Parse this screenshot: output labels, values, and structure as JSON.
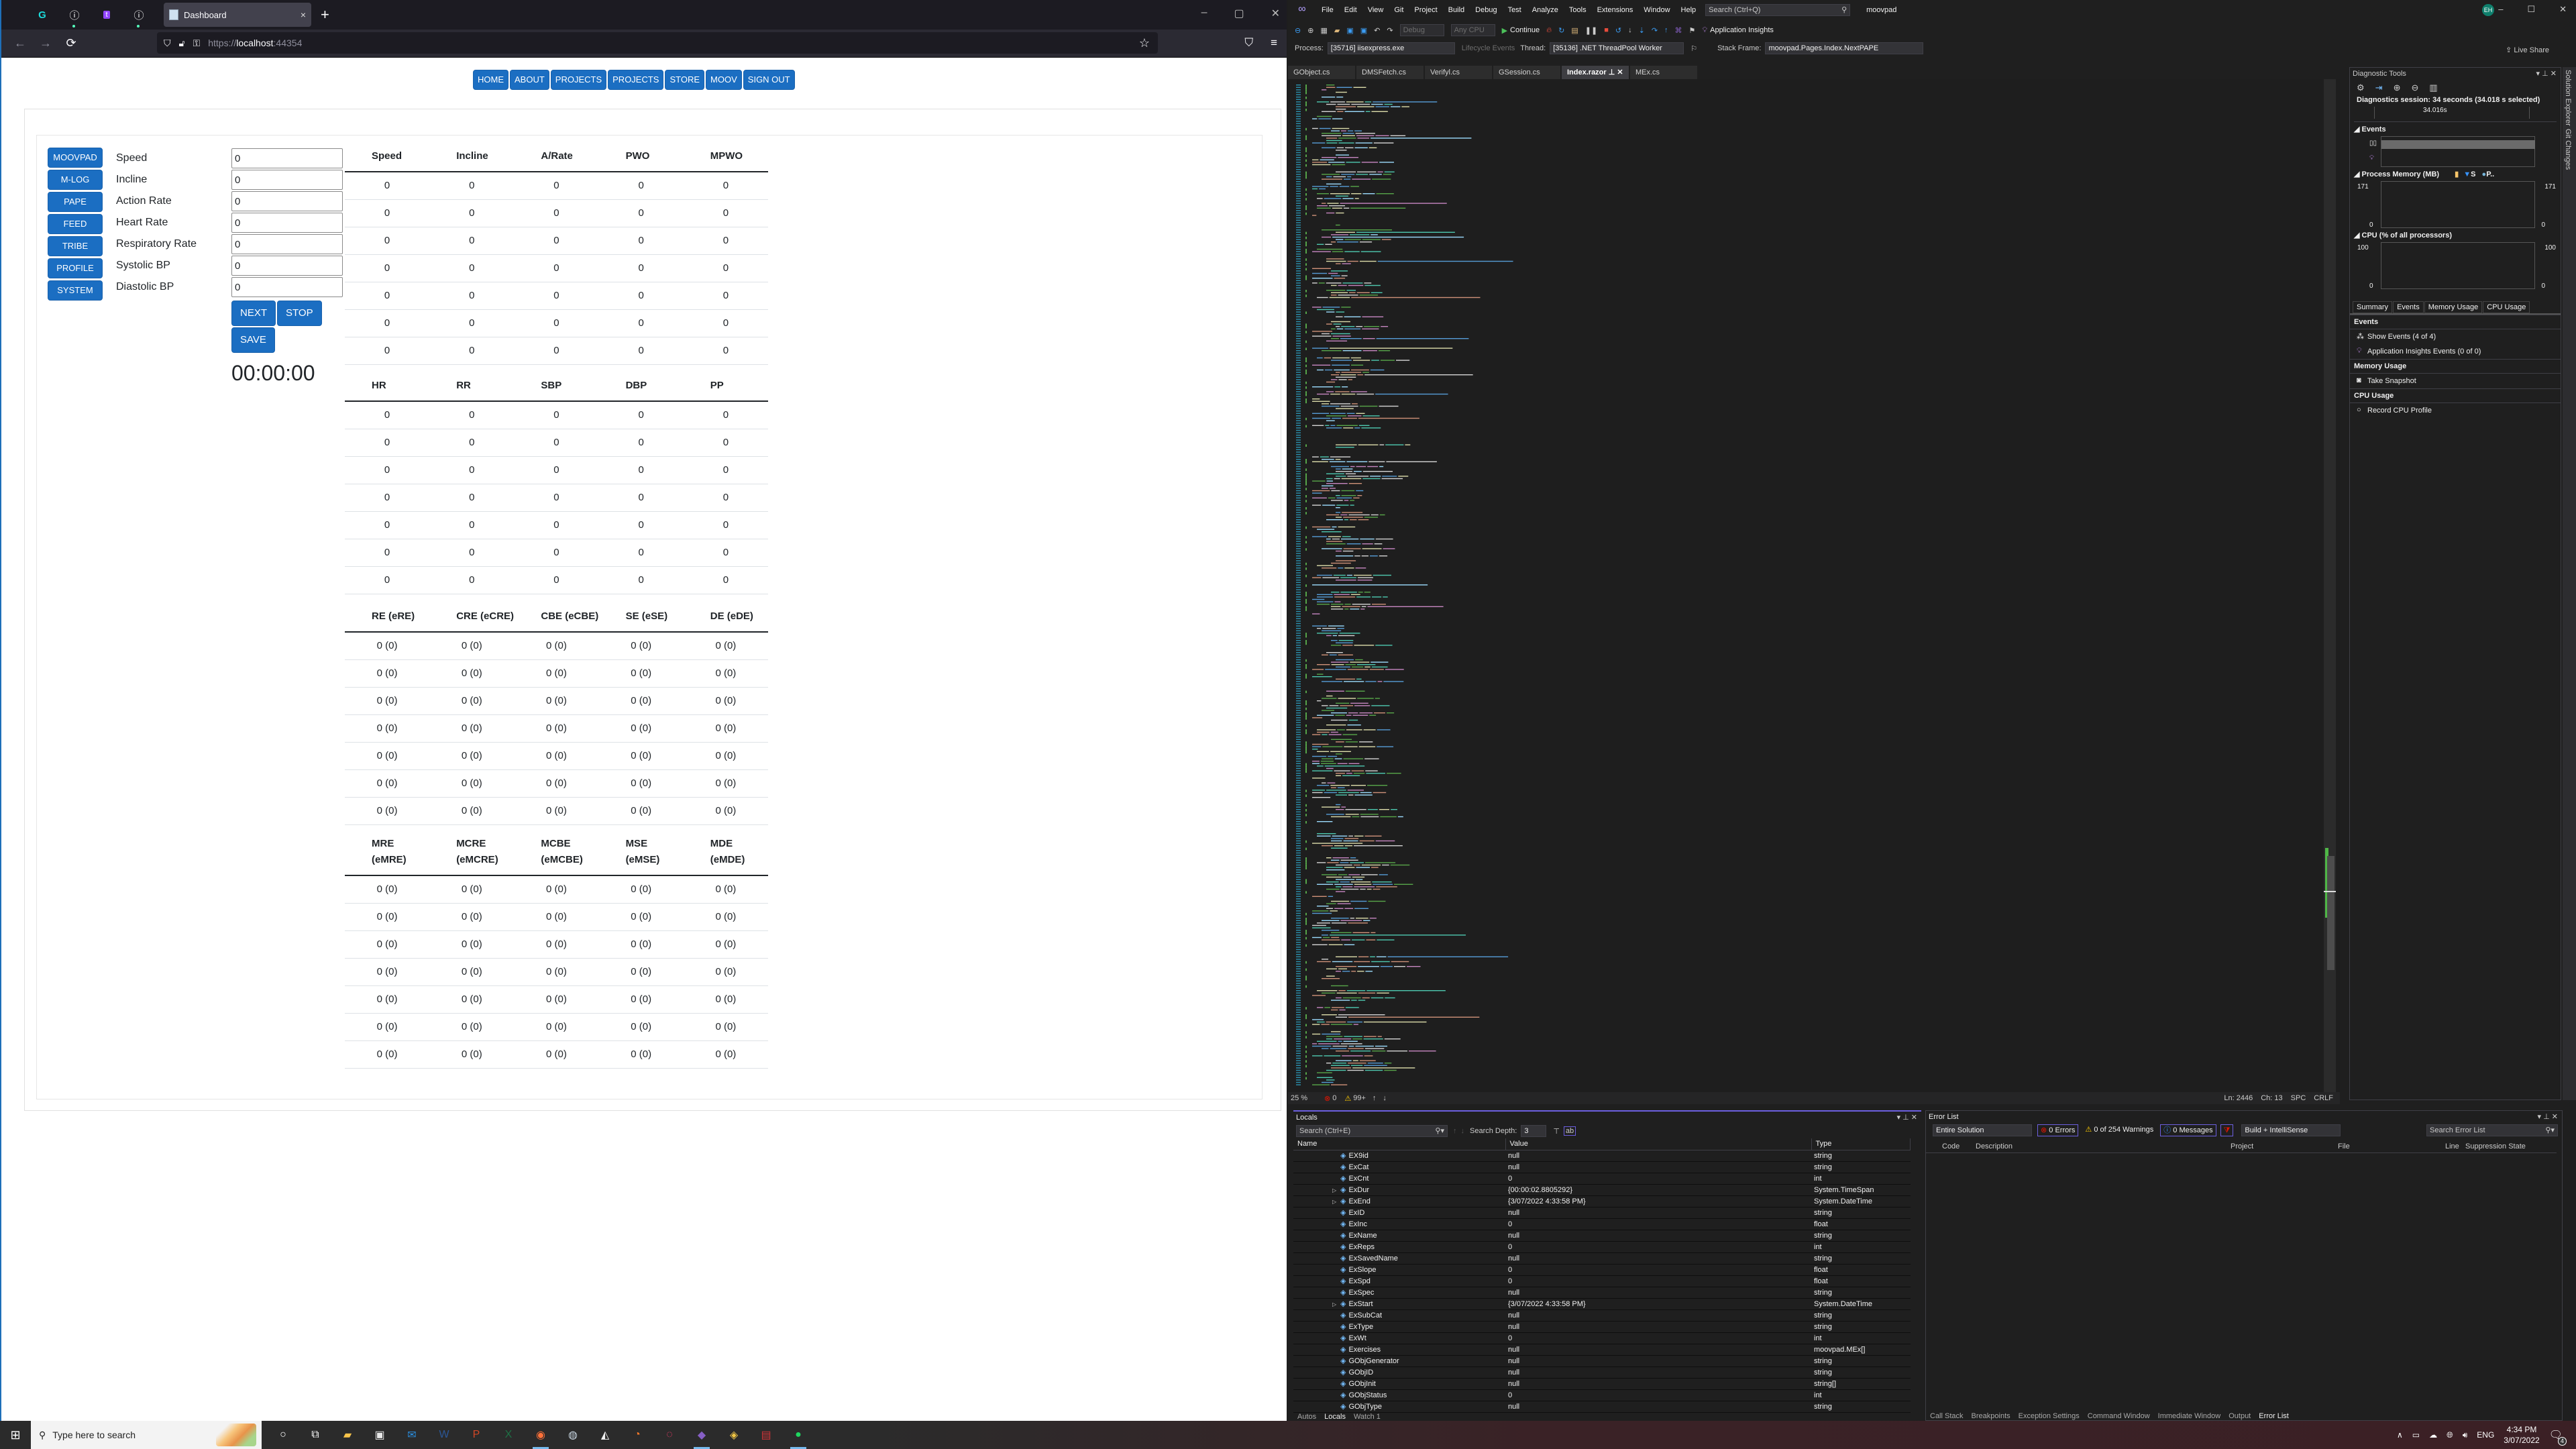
{
  "browser": {
    "pinned_tabs": [
      {
        "icon": "godaddy-icon"
      },
      {
        "icon": "info-icon"
      },
      {
        "icon": "twitch-icon"
      },
      {
        "icon": "info-icon"
      }
    ],
    "active_tab": {
      "title": "Dashboard",
      "close": "×"
    },
    "new_tab": "+",
    "window_controls": [
      "–",
      "▢",
      "✕"
    ],
    "url": {
      "scheme": "https://",
      "host": "localhost",
      "port": ":44354"
    },
    "nav": {
      "back": "←",
      "forward": "→",
      "reload": "⟳"
    }
  },
  "app": {
    "topnav": [
      "HOME",
      "ABOUT",
      "PROJECTS",
      "PROJECTS",
      "STORE",
      "MOOV",
      "SIGN OUT"
    ],
    "sidebar": [
      "MOOVPAD",
      "M-LOG",
      "PAPE",
      "FEED",
      "TRIBE",
      "PROFILE",
      "SYSTEM"
    ],
    "fields": [
      {
        "label": "Speed",
        "value": "0"
      },
      {
        "label": "Incline",
        "value": "0"
      },
      {
        "label": "Action Rate",
        "value": "0"
      },
      {
        "label": "Heart Rate",
        "value": "0"
      },
      {
        "label": "Respiratory Rate",
        "value": "0"
      },
      {
        "label": "Systolic BP",
        "value": "0"
      },
      {
        "label": "Diastolic BP",
        "value": "0"
      }
    ],
    "actions": {
      "next": "NEXT",
      "stop": "STOP",
      "save": "SAVE"
    },
    "timer": "00:00:00",
    "tables": [
      {
        "headers": [
          "Speed",
          "Incline",
          "A/Rate",
          "PWO",
          "MPWO"
        ],
        "rows": [
          [
            "0",
            "0",
            "0",
            "0",
            "0"
          ],
          [
            "0",
            "0",
            "0",
            "0",
            "0"
          ],
          [
            "0",
            "0",
            "0",
            "0",
            "0"
          ],
          [
            "0",
            "0",
            "0",
            "0",
            "0"
          ],
          [
            "0",
            "0",
            "0",
            "0",
            "0"
          ],
          [
            "0",
            "0",
            "0",
            "0",
            "0"
          ],
          [
            "0",
            "0",
            "0",
            "0",
            "0"
          ]
        ]
      },
      {
        "headers": [
          "HR",
          "RR",
          "SBP",
          "DBP",
          "PP"
        ],
        "rows": [
          [
            "0",
            "0",
            "0",
            "0",
            "0"
          ],
          [
            "0",
            "0",
            "0",
            "0",
            "0"
          ],
          [
            "0",
            "0",
            "0",
            "0",
            "0"
          ],
          [
            "0",
            "0",
            "0",
            "0",
            "0"
          ],
          [
            "0",
            "0",
            "0",
            "0",
            "0"
          ],
          [
            "0",
            "0",
            "0",
            "0",
            "0"
          ],
          [
            "0",
            "0",
            "0",
            "0",
            "0"
          ]
        ]
      },
      {
        "headers": [
          "RE (eRE)",
          "CRE (eCRE)",
          "CBE (eCBE)",
          "SE (eSE)",
          "DE (eDE)"
        ],
        "rows": [
          [
            "0 (0)",
            "0 (0)",
            "0 (0)",
            "0 (0)",
            "0 (0)"
          ],
          [
            "0 (0)",
            "0 (0)",
            "0 (0)",
            "0 (0)",
            "0 (0)"
          ],
          [
            "0 (0)",
            "0 (0)",
            "0 (0)",
            "0 (0)",
            "0 (0)"
          ],
          [
            "0 (0)",
            "0 (0)",
            "0 (0)",
            "0 (0)",
            "0 (0)"
          ],
          [
            "0 (0)",
            "0 (0)",
            "0 (0)",
            "0 (0)",
            "0 (0)"
          ],
          [
            "0 (0)",
            "0 (0)",
            "0 (0)",
            "0 (0)",
            "0 (0)"
          ],
          [
            "0 (0)",
            "0 (0)",
            "0 (0)",
            "0 (0)",
            "0 (0)"
          ]
        ]
      },
      {
        "headers": [
          "MRE (eMRE)",
          "MCRE (eMCRE)",
          "MCBE (eMCBE)",
          "MSE (eMSE)",
          "MDE (eMDE)"
        ],
        "rows": [
          [
            "0 (0)",
            "0 (0)",
            "0 (0)",
            "0 (0)",
            "0 (0)"
          ],
          [
            "0 (0)",
            "0 (0)",
            "0 (0)",
            "0 (0)",
            "0 (0)"
          ],
          [
            "0 (0)",
            "0 (0)",
            "0 (0)",
            "0 (0)",
            "0 (0)"
          ],
          [
            "0 (0)",
            "0 (0)",
            "0 (0)",
            "0 (0)",
            "0 (0)"
          ],
          [
            "0 (0)",
            "0 (0)",
            "0 (0)",
            "0 (0)",
            "0 (0)"
          ],
          [
            "0 (0)",
            "0 (0)",
            "0 (0)",
            "0 (0)",
            "0 (0)"
          ],
          [
            "0 (0)",
            "0 (0)",
            "0 (0)",
            "0 (0)",
            "0 (0)"
          ]
        ]
      }
    ]
  },
  "vs": {
    "menu": [
      "File",
      "Edit",
      "View",
      "Git",
      "Project",
      "Build",
      "Debug",
      "Test",
      "Analyze",
      "Tools",
      "Extensions",
      "Window",
      "Help"
    ],
    "search_placeholder": "Search (Ctrl+Q)",
    "solution": "moovpad",
    "avatar": "EH",
    "window_controls": [
      "–",
      "☐",
      "✕"
    ],
    "toolbar": {
      "config": "Debug",
      "platform": "Any CPU",
      "continue": "Continue",
      "app_insights": "Application Insights",
      "live_share": "Live Share"
    },
    "debugbar": {
      "process_label": "Process:",
      "process": "[35716] iisexpress.exe",
      "lifecycle": "Lifecycle Events",
      "thread_label": "Thread:",
      "thread": "[35136] .NET ThreadPool Worker",
      "stack_label": "Stack Frame:",
      "stack": "moovpad.Pages.Index.NextPAPE"
    },
    "doc_tabs": [
      "GObject.cs",
      "DMSFetch.cs",
      "Verifyl.cs",
      "GSession.cs",
      "Index.razor",
      "MEx.cs"
    ],
    "active_doc": "Index.razor",
    "editor_status": {
      "zoom": "25 %",
      "errors": "0",
      "warnings": "99+",
      "line": "Ln: 2446",
      "col": "Ch: 13",
      "spacing": "SPC",
      "eol": "CRLF"
    },
    "diagnostics": {
      "title": "Diagnostic Tools",
      "session": "Diagnostics session: 34 seconds (34.018 s selected)",
      "timeline_label": "34.016s",
      "events_title": "Events",
      "memory_title": "Process Memory (MB)",
      "memory_legend": [
        "S",
        "P.."
      ],
      "memory_max": "171",
      "memory_min": "0",
      "cpu_title": "CPU (% of all processors)",
      "cpu_max": "100",
      "cpu_min": "0",
      "tabs": [
        "Summary",
        "Events",
        "Memory Usage",
        "CPU Usage"
      ],
      "sections": [
        {
          "heading": "Events",
          "items": [
            {
              "icon": "events-icon",
              "label": "Show Events (4 of 4)"
            },
            {
              "icon": "lightbulb-icon",
              "label": "Application Insights Events (0 of 0)"
            }
          ]
        },
        {
          "heading": "Memory Usage",
          "items": [
            {
              "icon": "camera-icon",
              "label": "Take Snapshot"
            }
          ]
        },
        {
          "heading": "CPU Usage",
          "items": [
            {
              "icon": "record-icon",
              "label": "Record CPU Profile"
            }
          ]
        }
      ]
    },
    "side_strip": [
      "Solution Explorer",
      "Git Changes"
    ],
    "locals": {
      "title": "Locals",
      "search_placeholder": "Search (Ctrl+E)",
      "search_depth_label": "Search Depth:",
      "search_depth": "3",
      "columns": [
        "Name",
        "Value",
        "Type"
      ],
      "rows": [
        {
          "name": "EX9id",
          "value": "null",
          "type": "string",
          "expandable": false
        },
        {
          "name": "ExCat",
          "value": "null",
          "type": "string",
          "expandable": false
        },
        {
          "name": "ExCnt",
          "value": "0",
          "type": "int",
          "expandable": false
        },
        {
          "name": "ExDur",
          "value": "{00:00:02.8805292}",
          "type": "System.TimeSpan",
          "expandable": true
        },
        {
          "name": "ExEnd",
          "value": "{3/07/2022 4:33:58 PM}",
          "type": "System.DateTime",
          "expandable": true
        },
        {
          "name": "ExID",
          "value": "null",
          "type": "string",
          "expandable": false
        },
        {
          "name": "ExInc",
          "value": "0",
          "type": "float",
          "expandable": false
        },
        {
          "name": "ExName",
          "value": "null",
          "type": "string",
          "expandable": false
        },
        {
          "name": "ExReps",
          "value": "0",
          "type": "int",
          "expandable": false
        },
        {
          "name": "ExSavedName",
          "value": "null",
          "type": "string",
          "expandable": false
        },
        {
          "name": "ExSlope",
          "value": "0",
          "type": "float",
          "expandable": false
        },
        {
          "name": "ExSpd",
          "value": "0",
          "type": "float",
          "expandable": false
        },
        {
          "name": "ExSpec",
          "value": "null",
          "type": "string",
          "expandable": false
        },
        {
          "name": "ExStart",
          "value": "{3/07/2022 4:33:58 PM}",
          "type": "System.DateTime",
          "expandable": true
        },
        {
          "name": "ExSubCat",
          "value": "null",
          "type": "string",
          "expandable": false
        },
        {
          "name": "ExType",
          "value": "null",
          "type": "string",
          "expandable": false
        },
        {
          "name": "ExWt",
          "value": "0",
          "type": "int",
          "expandable": false
        },
        {
          "name": "Exercises",
          "value": "null",
          "type": "moovpad.MEx[]",
          "expandable": false
        },
        {
          "name": "GObjGenerator",
          "value": "null",
          "type": "string",
          "expandable": false
        },
        {
          "name": "GObjID",
          "value": "null",
          "type": "string",
          "expandable": false
        },
        {
          "name": "GObjInit",
          "value": "null",
          "type": "string[]",
          "expandable": false
        },
        {
          "name": "GObjStatus",
          "value": "0",
          "type": "int",
          "expandable": false
        },
        {
          "name": "GObjType",
          "value": "null",
          "type": "string",
          "expandable": false
        }
      ],
      "bottom_tabs": [
        "Autos",
        "Locals",
        "Watch 1"
      ],
      "active_bottom_tab": "Locals"
    },
    "error_list": {
      "title": "Error List",
      "scope": "Entire Solution",
      "errors": "0 Errors",
      "warnings": "0 of 254 Warnings",
      "messages": "0 Messages",
      "build_filter": "Build + IntelliSense",
      "search_placeholder": "Search Error List",
      "columns": [
        "",
        "Code",
        "Description",
        "Project",
        "File",
        "Line",
        "Suppression State"
      ],
      "bottom_tabs": [
        "Call Stack",
        "Breakpoints",
        "Exception Settings",
        "Command Window",
        "Immediate Window",
        "Output",
        "Error List"
      ],
      "active_bottom_tab": "Error List"
    }
  },
  "taskbar": {
    "search_placeholder": "Type here to search",
    "apps": [
      {
        "name": "cortana-icon",
        "glyph": "○",
        "color": "#ffffff",
        "running": false
      },
      {
        "name": "task-view-icon",
        "glyph": "⧉",
        "color": "#ffffff",
        "running": false
      },
      {
        "name": "file-explorer-icon",
        "glyph": "▰",
        "color": "#f8c44a",
        "running": false
      },
      {
        "name": "store-icon",
        "glyph": "▣",
        "color": "#e9e9e9",
        "running": false
      },
      {
        "name": "mail-icon",
        "glyph": "✉",
        "color": "#2a8fe0",
        "running": false
      },
      {
        "name": "word-icon",
        "glyph": "W",
        "color": "#2b5797",
        "running": false
      },
      {
        "name": "powerpoint-icon",
        "glyph": "P",
        "color": "#d24726",
        "running": false
      },
      {
        "name": "excel-icon",
        "glyph": "X",
        "color": "#1e7145",
        "running": false
      },
      {
        "name": "firefox-icon",
        "glyph": "◉",
        "color": "#ff7139",
        "running": true
      },
      {
        "name": "steam-icon",
        "glyph": "◍",
        "color": "#c7d5e0",
        "running": false
      },
      {
        "name": "inkscape-icon",
        "glyph": "◭",
        "color": "#eeeeee",
        "running": false
      },
      {
        "name": "blender-icon",
        "glyph": "◔",
        "color": "#f5792a",
        "running": false
      },
      {
        "name": "creative-cloud-icon",
        "glyph": "◌",
        "color": "#ff3b6e",
        "running": false
      },
      {
        "name": "visual-studio-icon",
        "glyph": "◆",
        "color": "#865fc5",
        "running": true
      },
      {
        "name": "git-extensions-icon",
        "glyph": "◈",
        "color": "#f2c744",
        "running": false
      },
      {
        "name": "toolbox-icon",
        "glyph": "▤",
        "color": "#d13438",
        "running": false
      },
      {
        "name": "spotify-icon",
        "glyph": "●",
        "color": "#1ed760",
        "running": true
      }
    ],
    "tray": {
      "language": "ENG",
      "time": "4:34 PM",
      "date": "3/07/2022",
      "notifications": "4"
    }
  }
}
